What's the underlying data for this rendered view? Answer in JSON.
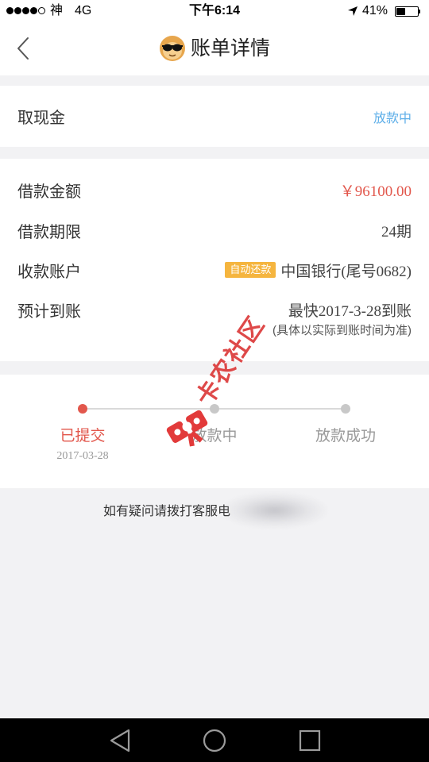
{
  "status_bar": {
    "signal_level": 4,
    "signal_max": 5,
    "carrier": "神",
    "network": "4G",
    "time": "下午6:14",
    "battery_percent": "41%",
    "battery_level": 0.41
  },
  "nav": {
    "title": "账单详情"
  },
  "summary": {
    "label": "取现金",
    "status": "放款中"
  },
  "details": [
    {
      "label": "借款金额",
      "value": "￥96100.00"
    },
    {
      "label": "借款期限",
      "value": "24期"
    },
    {
      "label": "收款账户",
      "badge": "自动还款",
      "value": "中国银行(尾号0682)"
    },
    {
      "label": "预计到账",
      "value": "最快2017-3-28到账",
      "note": "(具体以实际到账时间为准)"
    }
  ],
  "progress": {
    "steps": [
      {
        "label": "已提交",
        "date": "2017-03-28",
        "completed": true
      },
      {
        "label": "放款中",
        "completed": false
      },
      {
        "label": "放款成功",
        "completed": false
      }
    ]
  },
  "footer": {
    "help_text": "如有疑问请拨打客服电"
  },
  "watermark": {
    "text": "卡农社区"
  },
  "icons": {
    "back": "chevron-left-icon",
    "title": "sunglasses-face-icon",
    "location": "location-arrow-icon",
    "battery": "battery-icon",
    "system_back": "triangle-back-icon",
    "system_home": "circle-home-icon",
    "system_recent": "square-recents-icon"
  },
  "colors": {
    "accent_red": "#e2574c",
    "status_blue": "#5daee8",
    "badge_orange": "#f5b53f",
    "text": "#333333",
    "muted": "#999999",
    "background": "#f2f2f4",
    "divider": "#d9d9d9",
    "watermark_red": "#dc3a3a"
  }
}
